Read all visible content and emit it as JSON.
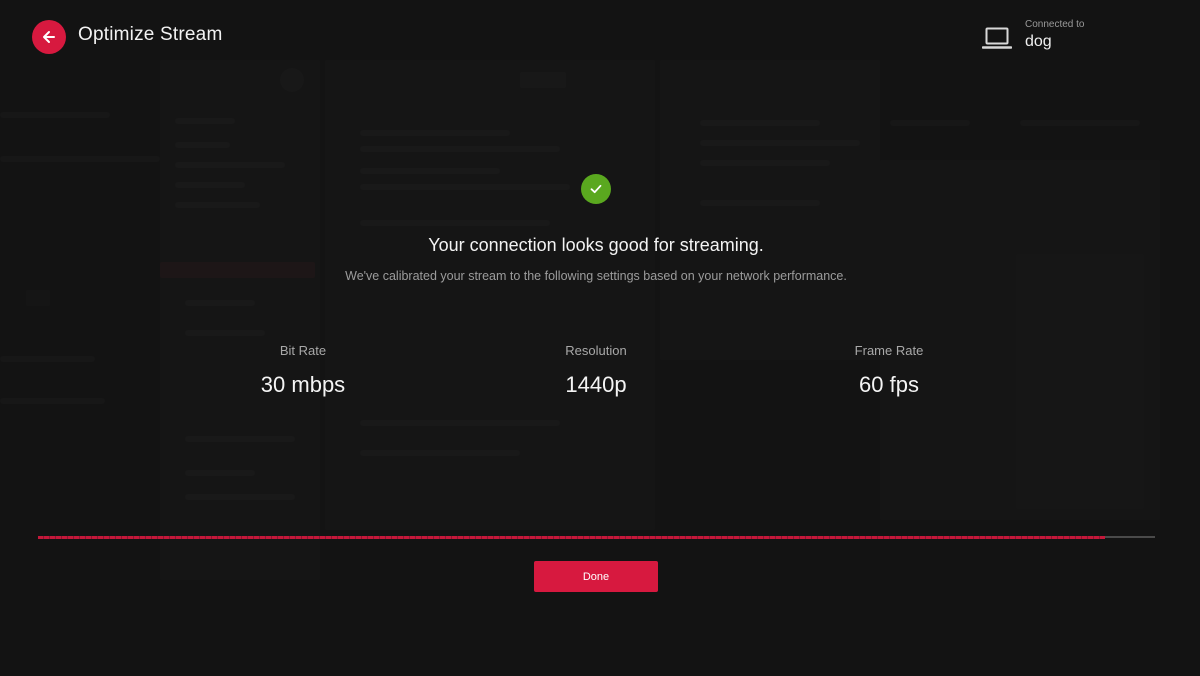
{
  "header": {
    "back_icon": "arrow-left-icon",
    "title": "Optimize Stream"
  },
  "connection": {
    "icon": "laptop-icon",
    "label": "Connected to",
    "device": "dog"
  },
  "result": {
    "status_icon": "checkmark-icon",
    "headline": "Your connection looks good for streaming.",
    "description": "We've calibrated your stream to the following settings based on your network performance."
  },
  "stats": {
    "bit_rate": {
      "label": "Bit Rate",
      "value": "30 mbps"
    },
    "resolution": {
      "label": "Resolution",
      "value": "1440p"
    },
    "frame_rate": {
      "label": "Frame Rate",
      "value": "60 fps"
    }
  },
  "progress": {
    "value": 0.955
  },
  "actions": {
    "done_label": "Done"
  },
  "colors": {
    "accent": "#d7193f",
    "success": "#5aa81f",
    "background": "#151515"
  }
}
